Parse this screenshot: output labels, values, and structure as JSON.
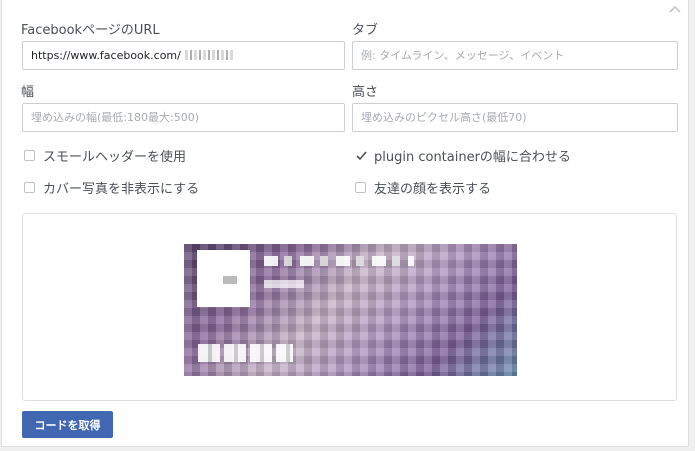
{
  "form": {
    "url": {
      "label": "FacebookページのURL",
      "value": "https://www.facebook.com/"
    },
    "tabs": {
      "label": "タブ",
      "placeholder": "例: タイムライン、メッセージ、イベント"
    },
    "width": {
      "label": "幅",
      "placeholder": "埋め込みの幅(最低:180最大:500)"
    },
    "height": {
      "label": "高さ",
      "placeholder": "埋め込みのピクセル高さ(最低70)"
    }
  },
  "options": [
    {
      "label": "スモールヘッダーを使用",
      "checked": false
    },
    {
      "label": "plugin containerの幅に合わせる",
      "checked": true
    },
    {
      "label": "カバー写真を非表示にする",
      "checked": false
    },
    {
      "label": "友達の顔を表示する",
      "checked": false
    }
  ],
  "actions": {
    "get_code_label": "コードを取得"
  },
  "colors": {
    "primary_button": "#4267b2",
    "border": "#ccd0d5",
    "text": "#4b4f56",
    "checkmark": "#4b4f56"
  },
  "icons": {
    "collapse": "chevron-up-icon",
    "checked": "check-icon"
  }
}
